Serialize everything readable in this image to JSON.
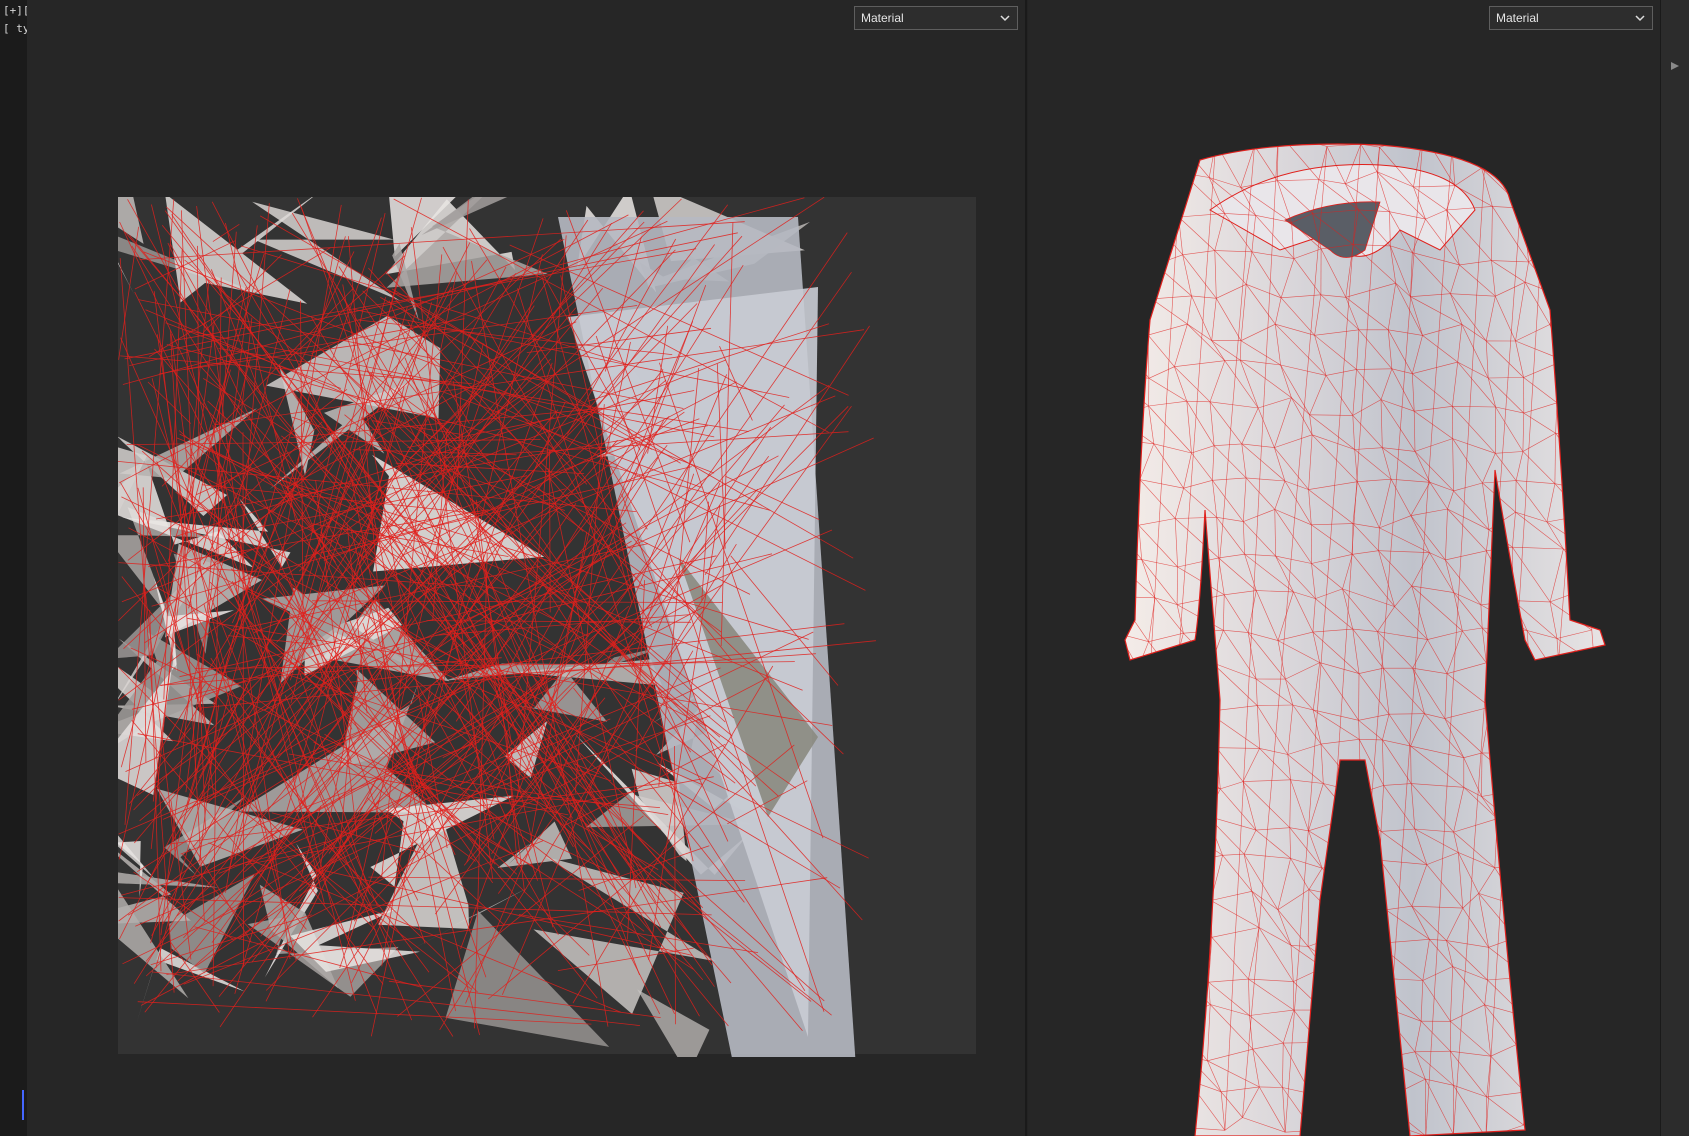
{
  "left_panel": {
    "labels": [
      "[+][",
      "[ tyFl"
    ],
    "viewport": {
      "shading_dropdown": "Material"
    }
  },
  "right_panel": {
    "viewport": {
      "shading_dropdown": "Material"
    }
  },
  "colors": {
    "wire": "#e0201c",
    "background": "#262626",
    "uv_backdrop": "#333333"
  },
  "icons": {
    "dropdown_chevron": "chevron-down-icon",
    "side_arrow": "arrow-right-icon"
  }
}
